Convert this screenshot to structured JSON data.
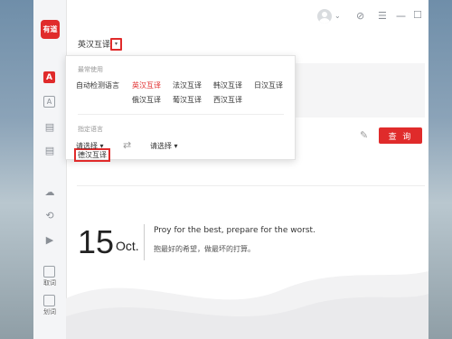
{
  "app": {
    "logo_text": "有道",
    "colors": {
      "accent": "#e02b2b"
    }
  },
  "titlebar": {
    "avatar_icon": "avatar-icon",
    "caret": "⌄",
    "pin": "⊘",
    "menu": "☰",
    "minimize": "—",
    "maximize": "☐",
    "close": "✕"
  },
  "sidebar": {
    "items": [
      {
        "icon": "A",
        "name": "translate-text"
      },
      {
        "icon": "A",
        "name": "translate-doc"
      },
      {
        "icon": "▤",
        "name": "dictionary"
      },
      {
        "icon": "▤",
        "name": "wordbook"
      },
      {
        "icon": "☁",
        "name": "cloud"
      },
      {
        "icon": "⟲",
        "name": "history"
      },
      {
        "icon": "▶",
        "name": "video"
      }
    ],
    "bottom": [
      {
        "label": "取词"
      },
      {
        "label": "划词"
      }
    ]
  },
  "main": {
    "lang_selector": {
      "label": "英汉互译",
      "arrow": "▾"
    },
    "query_button": "查 询",
    "edit_icon": "✎"
  },
  "dropdown": {
    "section_common": "最常使用",
    "items_row1": [
      "自动检测语言",
      "英汉互译",
      "法汉互译",
      "韩汉互译",
      "日汉互译"
    ],
    "items_row2": [
      "德汉互译",
      "俄汉互译",
      "葡汉互译",
      "西汉互译"
    ],
    "active_item": "英汉互译",
    "highlighted_item": "德汉互译",
    "section_specify": "指定语言",
    "from_select": "请选择 ▾",
    "to_select": "请选择 ▾",
    "swap_icon": "⇄"
  },
  "daily": {
    "day": "15",
    "month": "Oct.",
    "quote_en": "Proy for the best, prepare for the worst.",
    "quote_zh": "抱最好的希望，做最坏的打算。"
  }
}
